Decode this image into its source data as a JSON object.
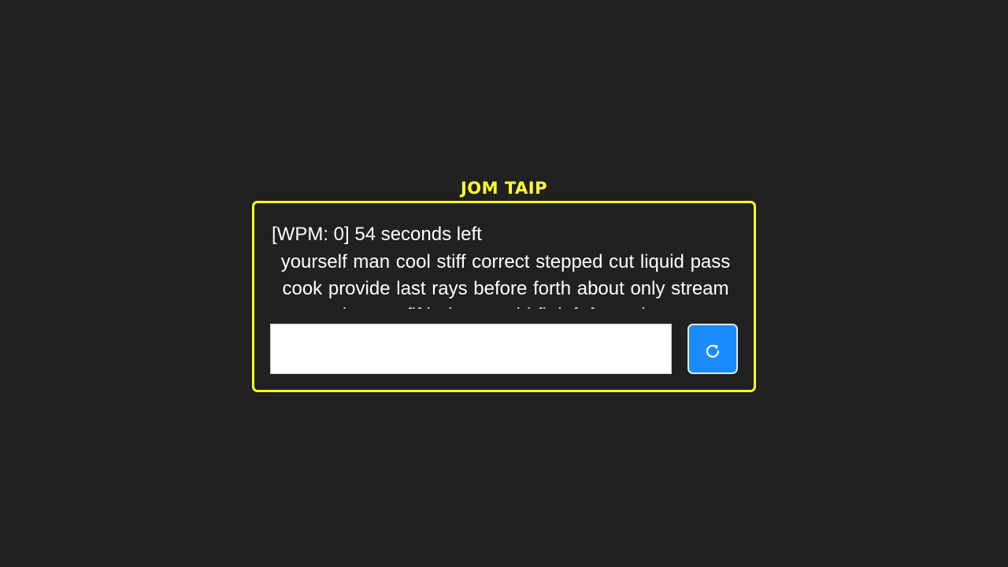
{
  "app": {
    "title": "JOM TAIP"
  },
  "status": {
    "text": "[WPM: 0] 54 seconds left"
  },
  "words": [
    "yourself",
    "man",
    "cool",
    "stiff",
    "correct",
    "stepped",
    "cut",
    "liquid",
    "pass",
    "cook",
    "provide",
    "last",
    "rays",
    "before",
    "forth",
    "about",
    "only",
    "stream",
    "bottom",
    "fifth",
    "then",
    "world",
    "fit",
    "left",
    "fact",
    "other"
  ],
  "input": {
    "value": "",
    "placeholder": ""
  },
  "reset_button": {
    "icon": "refresh-icon"
  },
  "colors": {
    "background": "#212121",
    "accent": "#ffff1f",
    "button": "#1a8cff"
  }
}
